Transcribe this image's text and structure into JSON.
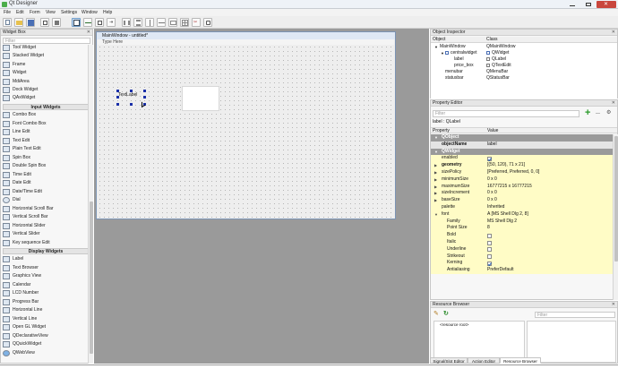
{
  "app": {
    "title": "Qt Designer"
  },
  "menu": [
    "File",
    "Edit",
    "Form",
    "View",
    "Settings",
    "Window",
    "Help"
  ],
  "widget_box": {
    "title": "Widget Box",
    "filter_placeholder": "Filter",
    "items_top": [
      {
        "label": "Tool Widget",
        "icon": "tool-widget-icon"
      },
      {
        "label": "Stacked Widget",
        "icon": "stacked-widget-icon"
      },
      {
        "label": "Frame",
        "icon": "frame-icon"
      },
      {
        "label": "Widget",
        "icon": "widget-icon"
      },
      {
        "label": "MdiArea",
        "icon": "mdi-area-icon"
      },
      {
        "label": "Dock Widget",
        "icon": "dock-widget-icon"
      },
      {
        "label": "QAxWidget",
        "icon": "ax-widget-icon"
      }
    ],
    "cat_input": "Input Widgets",
    "items_input": [
      {
        "label": "Combo Box",
        "icon": "combo-box-icon"
      },
      {
        "label": "Font Combo Box",
        "icon": "font-combo-box-icon"
      },
      {
        "label": "Line Edit",
        "icon": "line-edit-icon"
      },
      {
        "label": "Text Edit",
        "icon": "text-edit-icon"
      },
      {
        "label": "Plain Text Edit",
        "icon": "plain-text-edit-icon"
      },
      {
        "label": "Spin Box",
        "icon": "spin-box-icon"
      },
      {
        "label": "Double Spin Box",
        "icon": "double-spin-box-icon"
      },
      {
        "label": "Time Edit",
        "icon": "time-edit-icon"
      },
      {
        "label": "Date Edit",
        "icon": "date-edit-icon"
      },
      {
        "label": "Date/Time Edit",
        "icon": "datetime-edit-icon"
      },
      {
        "label": "Dial",
        "icon": "dial-icon"
      },
      {
        "label": "Horizontal Scroll Bar",
        "icon": "hscroll-icon"
      },
      {
        "label": "Vertical Scroll Bar",
        "icon": "vscroll-icon"
      },
      {
        "label": "Horizontal Slider",
        "icon": "hslider-icon"
      },
      {
        "label": "Vertical Slider",
        "icon": "vslider-icon"
      },
      {
        "label": "Key sequence Edit",
        "icon": "key-sequence-icon"
      }
    ],
    "cat_display": "Display Widgets",
    "items_display": [
      {
        "label": "Label",
        "icon": "label-icon"
      },
      {
        "label": "Text Browser",
        "icon": "text-browser-icon"
      },
      {
        "label": "Graphics View",
        "icon": "graphics-view-icon"
      },
      {
        "label": "Calendar",
        "icon": "calendar-icon"
      },
      {
        "label": "LCD Number",
        "icon": "lcd-number-icon"
      },
      {
        "label": "Progress Bar",
        "icon": "progress-bar-icon"
      },
      {
        "label": "Horizontal Line",
        "icon": "hline-icon"
      },
      {
        "label": "Vertical Line",
        "icon": "vline-icon"
      },
      {
        "label": "Open GL Widget",
        "icon": "opengl-icon"
      },
      {
        "label": "QDeclarativeView",
        "icon": "declarative-view-icon"
      },
      {
        "label": "QQuickWidget",
        "icon": "quick-widget-icon"
      },
      {
        "label": "QWebView",
        "icon": "web-view-icon"
      }
    ]
  },
  "form": {
    "window_title": "MainWindow - untitled*",
    "menu_placeholder": "Type Here",
    "label_text": "TextLabel"
  },
  "object_inspector": {
    "title": "Object Inspector",
    "col_object": "Object",
    "col_class": "Class",
    "rows": [
      {
        "object": "MainWindow",
        "class": "QMainWindow",
        "indent": 0
      },
      {
        "object": "centralwidget",
        "class": "QWidget",
        "indent": 1
      },
      {
        "object": "label",
        "class": "QLabel",
        "indent": 2
      },
      {
        "object": "price_box",
        "class": "QTextEdit",
        "indent": 2
      },
      {
        "object": "menubar",
        "class": "QMenuBar",
        "indent": 1
      },
      {
        "object": "statusbar",
        "class": "QStatusBar",
        "indent": 1
      }
    ]
  },
  "property_editor": {
    "title": "Property Editor",
    "filter_placeholder": "Filter",
    "context": "label : QLabel",
    "col_property": "Property",
    "col_value": "Value",
    "rows": [
      {
        "type": "sec",
        "key": "QObject",
        "value": ""
      },
      {
        "type": "sel",
        "key": "objectName",
        "value": "label"
      },
      {
        "type": "sec",
        "key": "QWidget",
        "value": ""
      },
      {
        "type": "y",
        "key": "enabled",
        "value": "",
        "check": true
      },
      {
        "type": "y",
        "key": "geometry",
        "value": "[(50, 120), 71 x 21]",
        "bold": true
      },
      {
        "type": "y",
        "key": "sizePolicy",
        "value": "[Preferred, Preferred, 0, 0]"
      },
      {
        "type": "y",
        "key": "minimumSize",
        "value": "0 x 0"
      },
      {
        "type": "y",
        "key": "maximumSize",
        "value": "16777215 x 16777215"
      },
      {
        "type": "y",
        "key": "sizeIncrement",
        "value": "0 x 0"
      },
      {
        "type": "y",
        "key": "baseSize",
        "value": "0 x 0"
      },
      {
        "type": "y",
        "key": "palette",
        "value": "Inherited"
      },
      {
        "type": "y",
        "key": "font",
        "value": "A  [MS Shell Dlg 2, 8]"
      },
      {
        "type": "y",
        "key": "Family",
        "value": "MS Shell Dlg 2",
        "sub": true
      },
      {
        "type": "y",
        "key": "Point Size",
        "value": "8",
        "sub": true
      },
      {
        "type": "y",
        "key": "Bold",
        "value": "",
        "check": false,
        "sub": true
      },
      {
        "type": "y",
        "key": "Italic",
        "value": "",
        "check": false,
        "sub": true
      },
      {
        "type": "y",
        "key": "Underline",
        "value": "",
        "check": false,
        "sub": true
      },
      {
        "type": "y",
        "key": "Strikeout",
        "value": "",
        "check": false,
        "sub": true
      },
      {
        "type": "y",
        "key": "Kerning",
        "value": "",
        "check": true,
        "sub": true
      },
      {
        "type": "y",
        "key": "Antialiasing",
        "value": "PreferDefault",
        "sub": true
      }
    ]
  },
  "resource_browser": {
    "title": "Resource Browser",
    "filter_placeholder": "Filter",
    "tree_item": "<resource root>"
  },
  "bottom_tabs": [
    "Signal/Slot Editor",
    "Action Editor",
    "Resource Browser"
  ]
}
